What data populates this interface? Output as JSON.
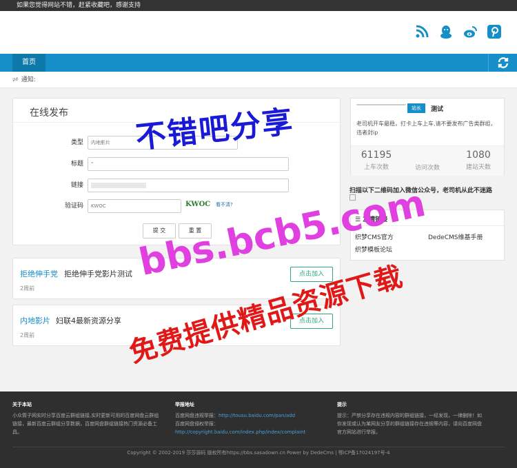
{
  "topbar": {
    "text": "如果您觉得网站不错，赶紧收藏吧，感谢支持"
  },
  "header": {
    "icons": [
      "rss-icon",
      "qq-icon",
      "weibo-icon",
      "pinterest-icon"
    ]
  },
  "nav": {
    "home": "首页"
  },
  "notice": {
    "label": "通知:"
  },
  "form": {
    "title": "在线发布",
    "type_label": "类型",
    "type_value": "内地影片",
    "title_label": "标题",
    "title_value": "\"",
    "link_label": "链接",
    "captcha_label": "验证码",
    "captcha_value": "KWOC",
    "captcha_image_text": "KWOC",
    "captcha_link": "看不清?",
    "submit": "提 交",
    "reset": "重 置"
  },
  "items": [
    {
      "category": "拒绝伸手党",
      "name": "拒绝伸手党影片测试",
      "time": "2周前",
      "action": "点击加入"
    },
    {
      "category": "内地影片",
      "name": "妇联4最新资源分享",
      "time": "2周前",
      "action": "点击加入"
    }
  ],
  "sidebar": {
    "badge": "站长",
    "user": "测试",
    "desc": "老司机开车最稳，打卡上车上车,请不要发布广告类群组，违者封ip",
    "stats": [
      {
        "value": "61195",
        "label": "上车次数"
      },
      {
        "value": "",
        "label": "访问次数"
      },
      {
        "value": "1080",
        "label": "建站天数"
      }
    ],
    "qr_text": "扫描以下二维码加入微信公众号，老司机从此不迷路",
    "links_title": "友情链接",
    "links": [
      "织梦CMS官方",
      "DedeCMS维基手册",
      "织梦模板论坛"
    ]
  },
  "watermark": {
    "line1": "不错吧分享",
    "line2": "bbs.bcb5.com",
    "line3": "免费提供精品资源下载"
  },
  "footer": {
    "about_title": "关于本站",
    "about_text": "小众筒子网实时分享百度云群组链接,实时更新可用的百度网盘云群组链接，最新百度云群组分享数据，百度网盘群组链接热门资源必备工具。",
    "report_title": "举报地址",
    "report_line1": "百度网盘违规举报：",
    "report_url1": "http://tousu.baidu.com/pan/add",
    "report_line2": "百度网盘侵权举报：",
    "report_url2": "http://copyright.baidu.com/index.php/index/complaint",
    "tip_title": "提示",
    "tip_text": "提示：严禁分享存在违规内容的群组链接，一经发现，一律删除！如你发现或认为某网友分享的群组链接存在违规等内容，请向百度网盘官方网站进行举报。",
    "copyright": "Copyright © 2002-2019 莎莎源码 版权所有https://bbs.sasadown.cn Power by DedeCms | 鄂ICP备17024197号-4"
  }
}
